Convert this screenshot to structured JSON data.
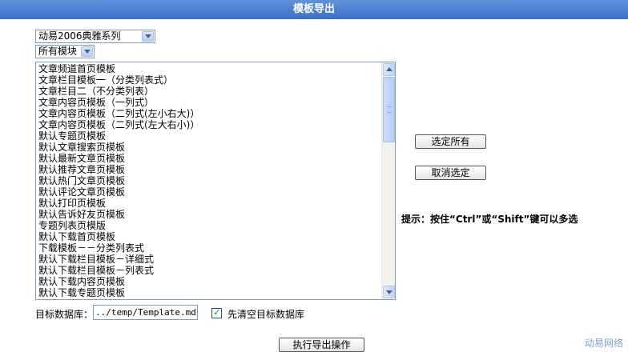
{
  "header": {
    "title": "模板导出"
  },
  "series_select": {
    "value": "动易2006典雅系列"
  },
  "module_select": {
    "value": "所有模块"
  },
  "template_list": {
    "items": [
      "文章频道首页模板",
      "文章栏目模板一（分类列表式）",
      "文章栏目二（不分类列表）",
      "文章内容页模板（一列式）",
      "文章内容页模板（二列式(左小右大)）",
      "文章内容页模板（二列式(左大右小)）",
      "默认专题页模板",
      "默认文章搜索页模板",
      "默认最新文章页模板",
      "默认推荐文章页模板",
      "默认热门文章页模板",
      "默认评论文章页模板",
      "默认打印页模板",
      "默认告诉好友页模板",
      "专题列表页模版",
      "默认下载首页模板",
      "下载模板－－分类列表式",
      "默认下载栏目模板－详细式",
      "默认下载栏目模板－列表式",
      "默认下载内容页模板",
      "默认下载专题页模板"
    ]
  },
  "buttons": {
    "select_all": "选定所有",
    "deselect": "取消选定",
    "export": "执行导出操作"
  },
  "hint": "提示：按住“Ctrl”或“Shift”键可以多选",
  "target": {
    "label": "目标数据库：",
    "value": "../temp/Template.mdb"
  },
  "clear_option": {
    "label": "先清空目标数据库",
    "checked": true
  },
  "watermark": "动易网络",
  "colors": {
    "titlebar": "#4a7fce",
    "border": "#7f9db9"
  }
}
